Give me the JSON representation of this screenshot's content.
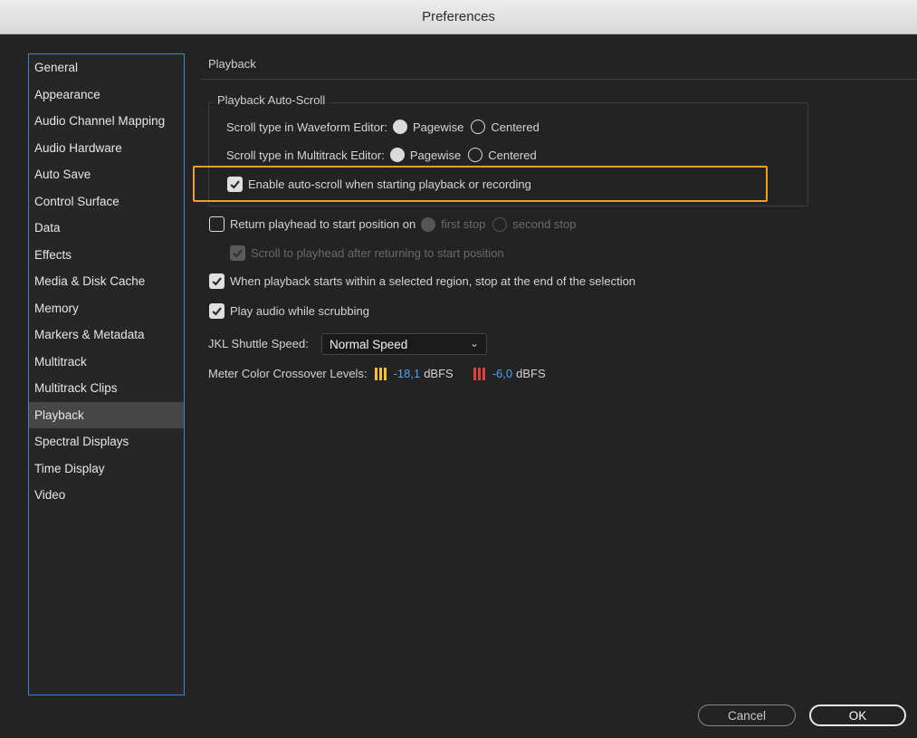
{
  "window": {
    "title": "Preferences"
  },
  "sidebar": {
    "items": [
      {
        "label": "General"
      },
      {
        "label": "Appearance"
      },
      {
        "label": "Audio Channel Mapping"
      },
      {
        "label": "Audio Hardware"
      },
      {
        "label": "Auto Save"
      },
      {
        "label": "Control Surface"
      },
      {
        "label": "Data"
      },
      {
        "label": "Effects"
      },
      {
        "label": "Media & Disk Cache"
      },
      {
        "label": "Memory"
      },
      {
        "label": "Markers & Metadata"
      },
      {
        "label": "Multitrack"
      },
      {
        "label": "Multitrack Clips"
      },
      {
        "label": "Playback"
      },
      {
        "label": "Spectral Displays"
      },
      {
        "label": "Time Display"
      },
      {
        "label": "Video"
      }
    ],
    "selected": "Playback"
  },
  "panel": {
    "title": "Playback",
    "autoscroll": {
      "legend": "Playback Auto-Scroll",
      "waveform_label": "Scroll type in Waveform Editor:",
      "multitrack_label": "Scroll type in Multitrack Editor:",
      "pagewise": "Pagewise",
      "centered": "Centered",
      "waveform_selected": "Pagewise",
      "multitrack_selected": "Pagewise",
      "enable_label": "Enable auto-scroll when starting playback or recording",
      "enable_checked": true
    },
    "return_playhead": {
      "label": "Return playhead to start position on",
      "checked": false,
      "first_stop": "first stop",
      "second_stop": "second stop",
      "scroll_label": "Scroll to playhead after returning to start position"
    },
    "stop_at_selection": {
      "label": "When playback starts within a selected region, stop at the end of the selection",
      "checked": true
    },
    "play_scrubbing": {
      "label": "Play audio while scrubbing",
      "checked": true
    },
    "jkl": {
      "label": "JKL Shuttle Speed:",
      "value": "Normal Speed"
    },
    "meter": {
      "label": "Meter Color Crossover Levels:",
      "level1_value": "-18,1",
      "level1_unit": "dBFS",
      "level2_value": "-6,0",
      "level2_unit": "dBFS",
      "yellow": "#f2c230",
      "red": "#e0403a"
    }
  },
  "buttons": {
    "cancel": "Cancel",
    "ok": "OK"
  },
  "colors": {
    "accent_focus": "#3b84d6",
    "highlight": "#f0a11c",
    "value_blue": "#4ba3f5"
  }
}
